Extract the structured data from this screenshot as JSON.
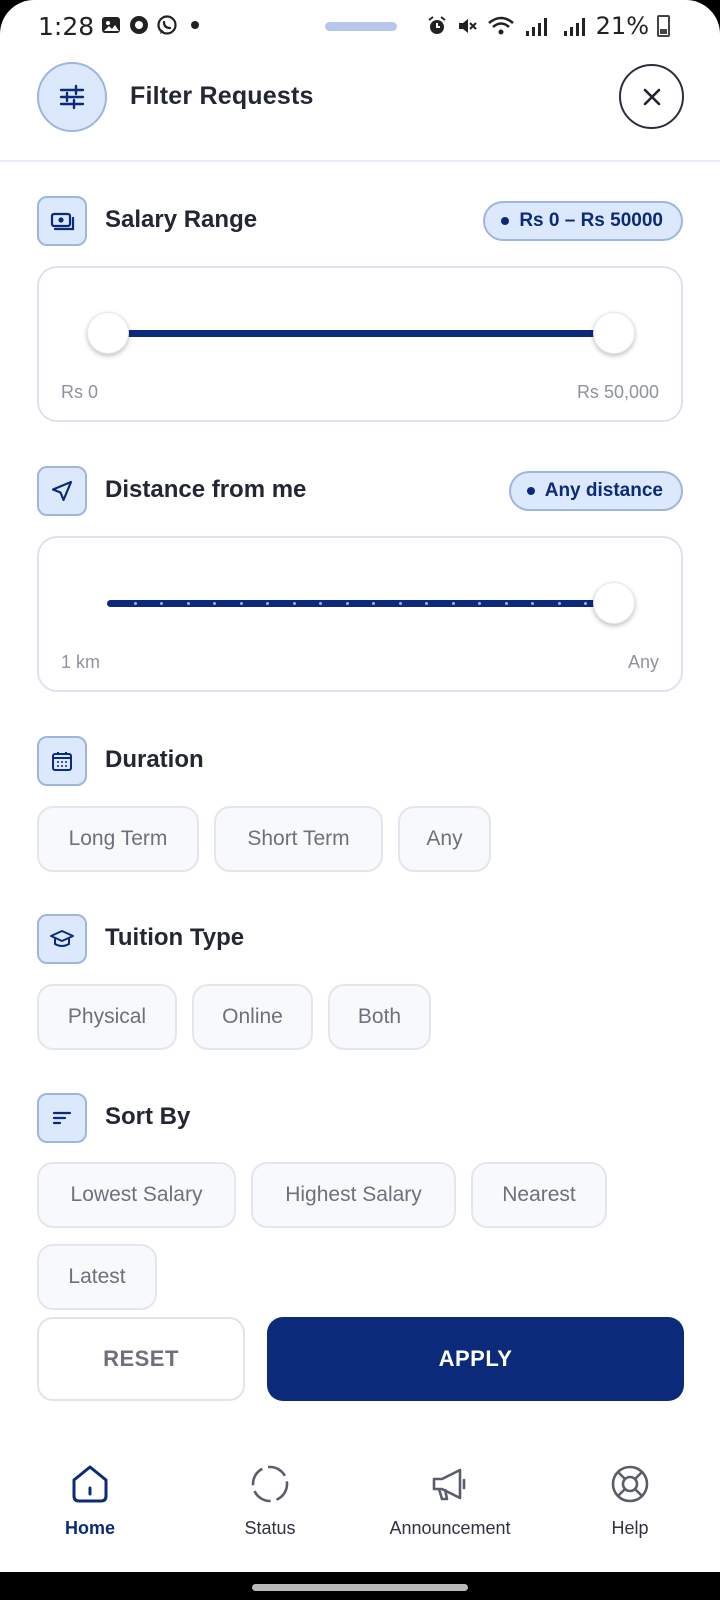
{
  "status_bar": {
    "time": "1:28",
    "battery": "21%"
  },
  "header": {
    "title": "Filter Requests"
  },
  "salary": {
    "title": "Salary Range",
    "badge": "Rs 0 – Rs 50000",
    "min_label": "Rs 0",
    "max_label": "Rs 50,000",
    "range_min": 0,
    "range_max": 50000,
    "value_low": 0,
    "value_high": 50000
  },
  "distance": {
    "title": "Distance from me",
    "badge": "Any distance",
    "min_label": "1 km",
    "max_label": "Any",
    "value_fraction": 1.0
  },
  "duration": {
    "title": "Duration",
    "options": [
      "Long Term",
      "Short Term",
      "Any"
    ]
  },
  "tuition_type": {
    "title": "Tuition Type",
    "options": [
      "Physical",
      "Online",
      "Both"
    ]
  },
  "sort_by": {
    "title": "Sort By",
    "options": [
      "Lowest Salary",
      "Highest Salary",
      "Nearest",
      "Latest"
    ]
  },
  "actions": {
    "reset": "RESET",
    "apply": "APPLY"
  },
  "bottom_nav": {
    "items": [
      {
        "label": "Home",
        "icon": "home-icon",
        "active": true
      },
      {
        "label": "Status",
        "icon": "status-icon",
        "active": false
      },
      {
        "label": "Announcement",
        "icon": "megaphone-icon",
        "active": false
      },
      {
        "label": "Help",
        "icon": "lifebuoy-icon",
        "active": false
      }
    ]
  },
  "colors": {
    "primary": "#0b2b7a",
    "accent_bg": "#dce8fb",
    "accent_border": "#9fb5de",
    "chip_bg": "#f8f9fb"
  }
}
